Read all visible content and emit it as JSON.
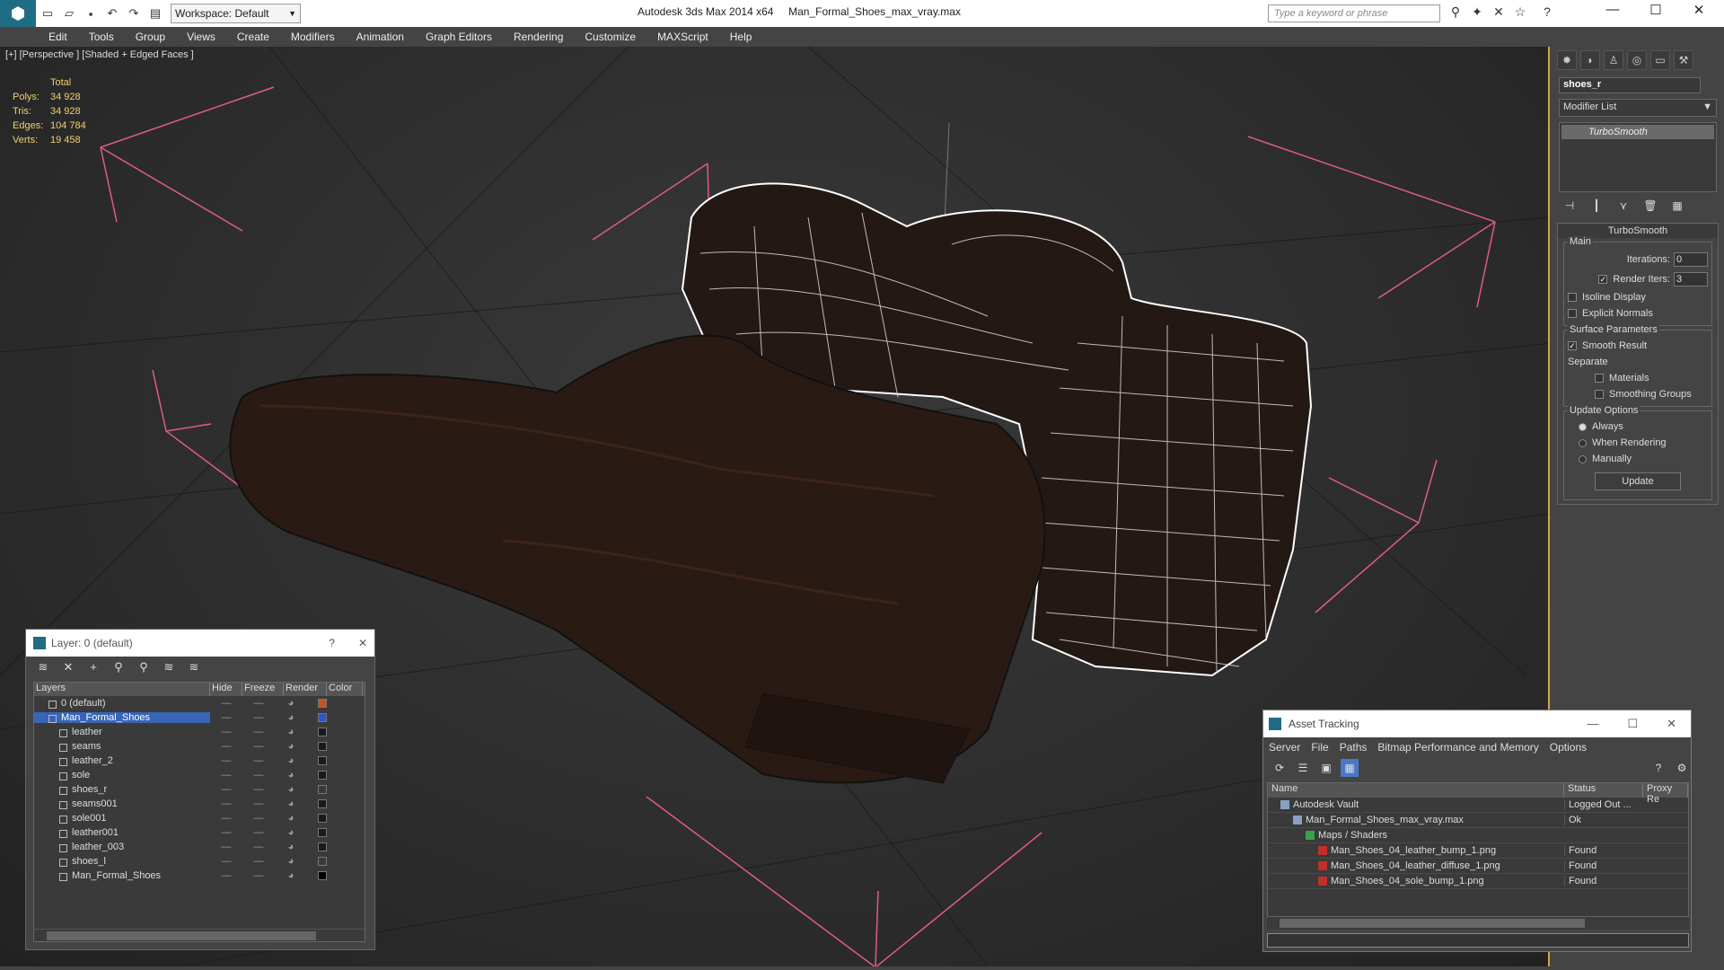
{
  "app": {
    "title": "Autodesk 3ds Max 2014 x64     Man_Formal_Shoes_max_vray.max",
    "workspace": "Workspace: Default",
    "search_placeholder": "Type a keyword or phrase"
  },
  "menu": [
    "Edit",
    "Tools",
    "Group",
    "Views",
    "Create",
    "Modifiers",
    "Animation",
    "Graph Editors",
    "Rendering",
    "Customize",
    "MAXScript",
    "Help"
  ],
  "viewport": {
    "label": "[+] [Perspective ] [Shaded + Edged Faces ]",
    "stats": {
      "header": "Total",
      "rows": [
        [
          "Polys:",
          "34 928"
        ],
        [
          "Tris:",
          "34 928"
        ],
        [
          "Edges:",
          "104 784"
        ],
        [
          "Verts:",
          "19 458"
        ]
      ]
    }
  },
  "command_panel": {
    "object_name": "shoes_r",
    "modifier_list": "Modifier List",
    "stack_item": "TurboSmooth",
    "rollout_title": "TurboSmooth",
    "main_group": "Main",
    "iterations_label": "Iterations:",
    "iterations": "0",
    "render_iters_label": "Render Iters:",
    "render_iters": "3",
    "isoline": "Isoline Display",
    "explicit": "Explicit Normals",
    "surface_group": "Surface Parameters",
    "smooth_result": "Smooth Result",
    "separate": "Separate",
    "materials": "Materials",
    "smoothing_groups": "Smoothing Groups",
    "update_group": "Update Options",
    "always": "Always",
    "when_rendering": "When Rendering",
    "manually": "Manually",
    "update_btn": "Update"
  },
  "layer_dialog": {
    "title": "Layer: 0 (default)",
    "help": "?",
    "cols": [
      "Layers",
      "Hide",
      "Freeze",
      "Render",
      "Color"
    ],
    "rows": [
      {
        "name": "0 (default)",
        "color": "#c8501e"
      },
      {
        "name": "Man_Formal_Shoes",
        "color": "#2a56c8"
      },
      {
        "name": "leather",
        "color": "#1a1a1a"
      },
      {
        "name": "seams",
        "color": "#1a1a1a"
      },
      {
        "name": "leather_2",
        "color": "#1a1a1a"
      },
      {
        "name": "sole",
        "color": "#1a1a1a"
      },
      {
        "name": "shoes_r",
        "color": "#3a3a3a"
      },
      {
        "name": "seams001",
        "color": "#1a1a1a"
      },
      {
        "name": "sole001",
        "color": "#1a1a1a"
      },
      {
        "name": "leather001",
        "color": "#1a1a1a"
      },
      {
        "name": "leather_003",
        "color": "#1a1a1a"
      },
      {
        "name": "shoes_l",
        "color": "#3a3a3a"
      },
      {
        "name": "Man_Formal_Shoes",
        "color": "#000000"
      }
    ]
  },
  "asset_tracking": {
    "title": "Asset Tracking",
    "menu": [
      "Server",
      "File",
      "Paths",
      "Bitmap Performance and Memory",
      "Options"
    ],
    "cols": [
      "Name",
      "Status",
      "Proxy Re"
    ],
    "rows": [
      {
        "name": "Autodesk Vault",
        "status": "Logged Out ...",
        "indent": 1
      },
      {
        "name": "Man_Formal_Shoes_max_vray.max",
        "status": "Ok",
        "indent": 2
      },
      {
        "name": "Maps / Shaders",
        "status": "",
        "indent": 3
      },
      {
        "name": "Man_Shoes_04_leather_bump_1.png",
        "status": "Found",
        "indent": 4
      },
      {
        "name": "Man_Shoes_04_leather_diffuse_1.png",
        "status": "Found",
        "indent": 4
      },
      {
        "name": "Man_Shoes_04_sole_bump_1.png",
        "status": "Found",
        "indent": 4
      }
    ]
  }
}
